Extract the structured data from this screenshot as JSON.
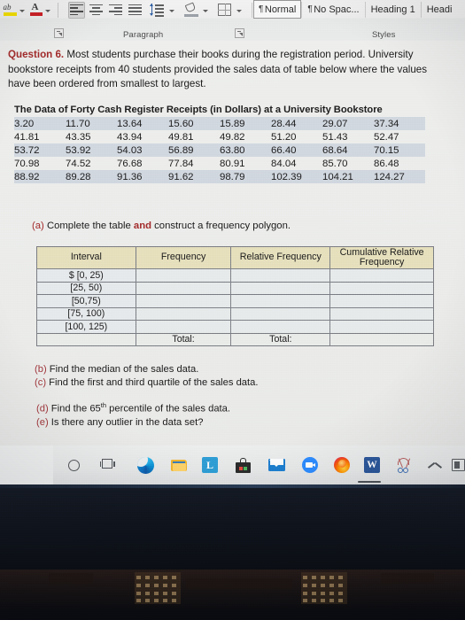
{
  "ribbon": {
    "groups": [
      {
        "name": "Paragraph",
        "label": "Paragraph"
      },
      {
        "name": "Styles",
        "label": "Styles"
      }
    ],
    "tools": [
      {
        "name": "text-highlight-color",
        "tooltip": "Text Highlight Color"
      },
      {
        "name": "font-color",
        "tooltip": "Font Color"
      },
      {
        "name": "align-left",
        "tooltip": "Align Left"
      },
      {
        "name": "align-center",
        "tooltip": "Center"
      },
      {
        "name": "align-right",
        "tooltip": "Align Right"
      },
      {
        "name": "justify",
        "tooltip": "Justify"
      },
      {
        "name": "line-spacing",
        "tooltip": "Line and Paragraph Spacing"
      },
      {
        "name": "shading",
        "tooltip": "Shading"
      },
      {
        "name": "borders",
        "tooltip": "Borders"
      }
    ],
    "styles": [
      {
        "label": "Normal",
        "pilcrow": "¶",
        "active": true
      },
      {
        "label": "No Spac...",
        "pilcrow": "¶",
        "active": false
      },
      {
        "label": "Heading 1",
        "pilcrow": "",
        "active": false
      },
      {
        "label": "Headi",
        "pilcrow": "",
        "active": false
      }
    ]
  },
  "document": {
    "question": {
      "label": "Question 6.",
      "body": " Most students purchase their books during the registration period. University bookstore receipts from 40 students provided the sales data of table below where the values have been ordered from smallest to largest."
    },
    "data_table": {
      "title": "The Data of Forty Cash Register Receipts (in Dollars) at a University Bookstore",
      "rows": [
        [
          "3.20",
          "11.70",
          "13.64",
          "15.60",
          "15.89",
          "28.44",
          "29.07",
          "37.34"
        ],
        [
          "41.81",
          "43.35",
          "43.94",
          "49.81",
          "49.82",
          "51.20",
          "51.43",
          "52.47"
        ],
        [
          "53.72",
          "53.92",
          "54.03",
          "56.89",
          "63.80",
          "66.40",
          "68.64",
          "70.15"
        ],
        [
          "70.98",
          "74.52",
          "76.68",
          "77.84",
          "80.91",
          "84.04",
          "85.70",
          "86.48"
        ],
        [
          "88.92",
          "89.28",
          "91.36",
          "91.62",
          "98.79",
          "102.39",
          "104.21",
          "124.27"
        ]
      ]
    },
    "part_a": {
      "label": "(a)",
      "text_before": " Complete the table ",
      "emphasis": "and",
      "text_after": " construct a frequency polygon."
    },
    "frequency_table": {
      "headers": [
        "Interval",
        "Frequency",
        "Relative Frequency",
        "Cumulative Relative Frequency"
      ],
      "intervals": [
        "$ [0, 25)",
        "[25, 50)",
        "[50,75)",
        "[75, 100)",
        "[100, 125)"
      ],
      "cell_values": [
        [
          "",
          "",
          ""
        ],
        [
          "",
          "",
          ""
        ],
        [
          "",
          "",
          ""
        ],
        [
          "",
          "",
          ""
        ],
        [
          "",
          "",
          ""
        ]
      ],
      "total_row": [
        "",
        "Total:",
        "Total:",
        ""
      ]
    },
    "parts": [
      {
        "label": "(b)",
        "text": " Find the median of the sales data."
      },
      {
        "label": "(c)",
        "text": " Find the first and third quartile of the sales data."
      },
      {
        "label": "(d)",
        "text": " Find the 65",
        "sup": "th",
        "text2": " percentile of the sales data."
      },
      {
        "label": "(e)",
        "text": " Is there any outlier in the data set?"
      }
    ]
  },
  "taskbar": {
    "items": [
      {
        "name": "search-icon",
        "label": "Search"
      },
      {
        "name": "task-view-icon",
        "label": "Task View"
      },
      {
        "name": "edge-icon",
        "label": "Microsoft Edge"
      },
      {
        "name": "file-explorer-icon",
        "label": "File Explorer"
      },
      {
        "name": "lockdown-browser-icon",
        "label": "L"
      },
      {
        "name": "microsoft-store-icon",
        "label": "Microsoft Store"
      },
      {
        "name": "mail-icon",
        "label": "Mail"
      },
      {
        "name": "zoom-icon",
        "label": "Zoom"
      },
      {
        "name": "firefox-icon",
        "label": "Firefox"
      },
      {
        "name": "word-icon",
        "label": "W"
      },
      {
        "name": "snipping-tool-icon",
        "label": "Snip & Sketch"
      },
      {
        "name": "show-hidden-icons-chevron",
        "label": "Show hidden icons"
      },
      {
        "name": "tray-icon",
        "label": "Tray"
      }
    ]
  },
  "colors": {
    "accent_red": "#a32b2b",
    "table_header_beige": "#e6e0bd",
    "page_background": "#ecedeb",
    "ribbon_background": "#eeeeee",
    "data_row_stripe": "#b5c2d3",
    "word_blue": "#2b579a"
  }
}
